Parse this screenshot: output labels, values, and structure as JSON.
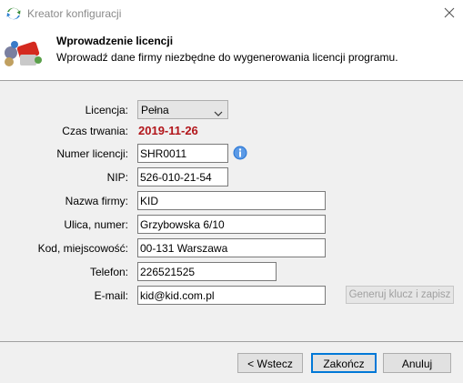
{
  "window": {
    "title": "Kreator konfiguracji"
  },
  "header": {
    "title": "Wprowadzenie licencji",
    "subtitle": "Wprowadź dane firmy niezbędne do wygenerowania licencji programu."
  },
  "form": {
    "license": {
      "label": "Licencja:",
      "value": "Pełna"
    },
    "duration": {
      "label": "Czas trwania:",
      "value": "2019-11-26"
    },
    "license_number": {
      "label": "Numer licencji:",
      "value": "SHR0011"
    },
    "nip": {
      "label": "NIP:",
      "value": "526-010-21-54"
    },
    "company": {
      "label": "Nazwa firmy:",
      "value": "KID"
    },
    "street": {
      "label": "Ulica, numer:",
      "value": "Grzybowska 6/10"
    },
    "city": {
      "label": "Kod, miejscowość:",
      "value": "00-131 Warszawa"
    },
    "phone": {
      "label": "Telefon:",
      "value": "226521525"
    },
    "email": {
      "label": "E-mail:",
      "value": "kid@kid.com.pl"
    },
    "generate_button": "Generuj klucz i zapisz"
  },
  "footer": {
    "back": "< Wstecz",
    "finish": "Zakończ",
    "cancel": "Anuluj"
  },
  "colors": {
    "accent": "#0078d7",
    "duration": "#b2161b",
    "info": "#2f7ad6"
  }
}
